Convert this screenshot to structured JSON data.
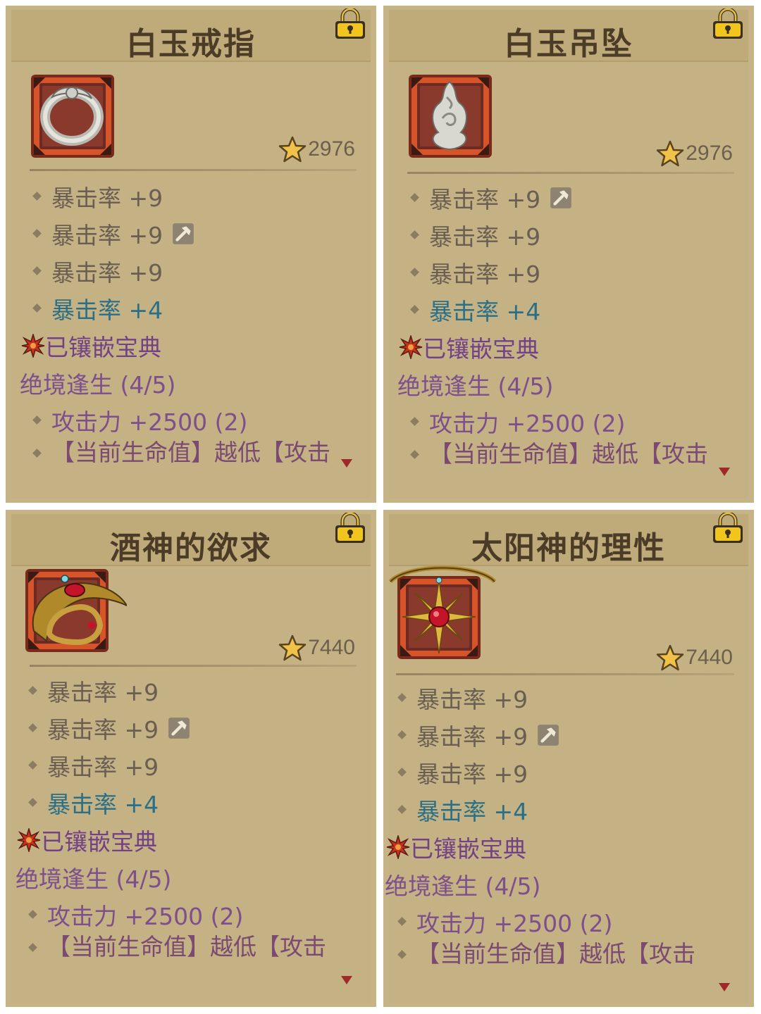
{
  "cards": [
    {
      "title": "白玉戒指",
      "score": "2976",
      "stats": [
        "暴击率 +9",
        "暴击率 +9",
        "暴击率 +9"
      ],
      "bonus_stat": "暴击率 +4",
      "socket_label": "已镶嵌宝典",
      "set_name": "绝境逢生 (4/5)",
      "set_effect_1": "攻击力 +2500 (2)",
      "set_effect_2": "【当前生命值】越低【攻击"
    },
    {
      "title": "白玉吊坠",
      "score": "2976",
      "stats": [
        "暴击率 +9",
        "暴击率 +9",
        "暴击率 +9"
      ],
      "bonus_stat": "暴击率 +4",
      "socket_label": "已镶嵌宝典",
      "set_name": "绝境逢生 (4/5)",
      "set_effect_1": "攻击力 +2500 (2)",
      "set_effect_2": "【当前生命值】越低【攻击"
    },
    {
      "title": "酒神的欲求",
      "score": "7440",
      "stats": [
        "暴击率 +9",
        "暴击率 +9",
        "暴击率 +9"
      ],
      "bonus_stat": "暴击率 +4",
      "socket_label": "已镶嵌宝典",
      "set_name": "绝境逢生 (4/5)",
      "set_effect_1": "攻击力 +2500 (2)",
      "set_effect_2": "【当前生命值】越低【攻击"
    },
    {
      "title": "太阳神的理性",
      "score": "7440",
      "stats": [
        "暴击率 +9",
        "暴击率 +9",
        "暴击率 +9"
      ],
      "bonus_stat": "暴击率 +4",
      "socket_label": "已镶嵌宝典",
      "set_name": "绝境逢生 (4/5)",
      "set_effect_1": "攻击力 +2500 (2)",
      "set_effect_2": "【当前生命值】越低【攻击"
    }
  ],
  "colors": {
    "panel_bg": "#c4b184",
    "title_text": "#4b3b27",
    "stat_gray": "#6a5e52",
    "stat_blue": "#2a6f86",
    "set_purple": "#7d4f8c",
    "lock_gold": "#f0c020",
    "emblem_frame": "#d84a22"
  },
  "icons": {
    "lock": "lock-icon",
    "star": "star-icon",
    "hammer": "hammer-icon",
    "socket": "socket-star-icon",
    "scroll": "scroll-down-arrow-icon"
  }
}
